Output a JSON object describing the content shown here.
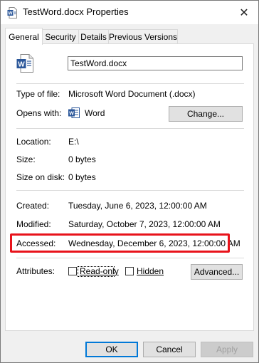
{
  "window": {
    "title": "TestWord.docx Properties",
    "close_glyph": "✕"
  },
  "tabs": [
    {
      "label": "General"
    },
    {
      "label": "Security"
    },
    {
      "label": "Details"
    },
    {
      "label": "Previous Versions"
    }
  ],
  "general": {
    "file_name": "TestWord.docx",
    "type_label": "Type of file:",
    "type_value": "Microsoft Word Document (.docx)",
    "opens_label": "Opens with:",
    "opens_value": "Word",
    "change_button": "Change...",
    "location_label": "Location:",
    "location_value": "E:\\",
    "size_label": "Size:",
    "size_value": "0 bytes",
    "size_disk_label": "Size on disk:",
    "size_disk_value": "0 bytes",
    "created_label": "Created:",
    "created_value": "Tuesday, June 6, 2023, 12:00:00 AM",
    "modified_label": "Modified:",
    "modified_value": "Saturday, October 7, 2023, 12:00:00 AM",
    "accessed_label": "Accessed:",
    "accessed_value": "Wednesday, December 6, 2023, 12:00:00 AM",
    "attributes_label": "Attributes:",
    "readonly_label": "Read-only",
    "hidden_label": "Hidden",
    "advanced_button": "Advanced..."
  },
  "footer": {
    "ok": "OK",
    "cancel": "Cancel",
    "apply": "Apply"
  },
  "colors": {
    "highlight": "#e8131b",
    "word_blue": "#2b579a"
  },
  "icons": {
    "title": "word-doc-icon",
    "file": "word-doc-icon",
    "opens_with": "word-app-icon"
  }
}
